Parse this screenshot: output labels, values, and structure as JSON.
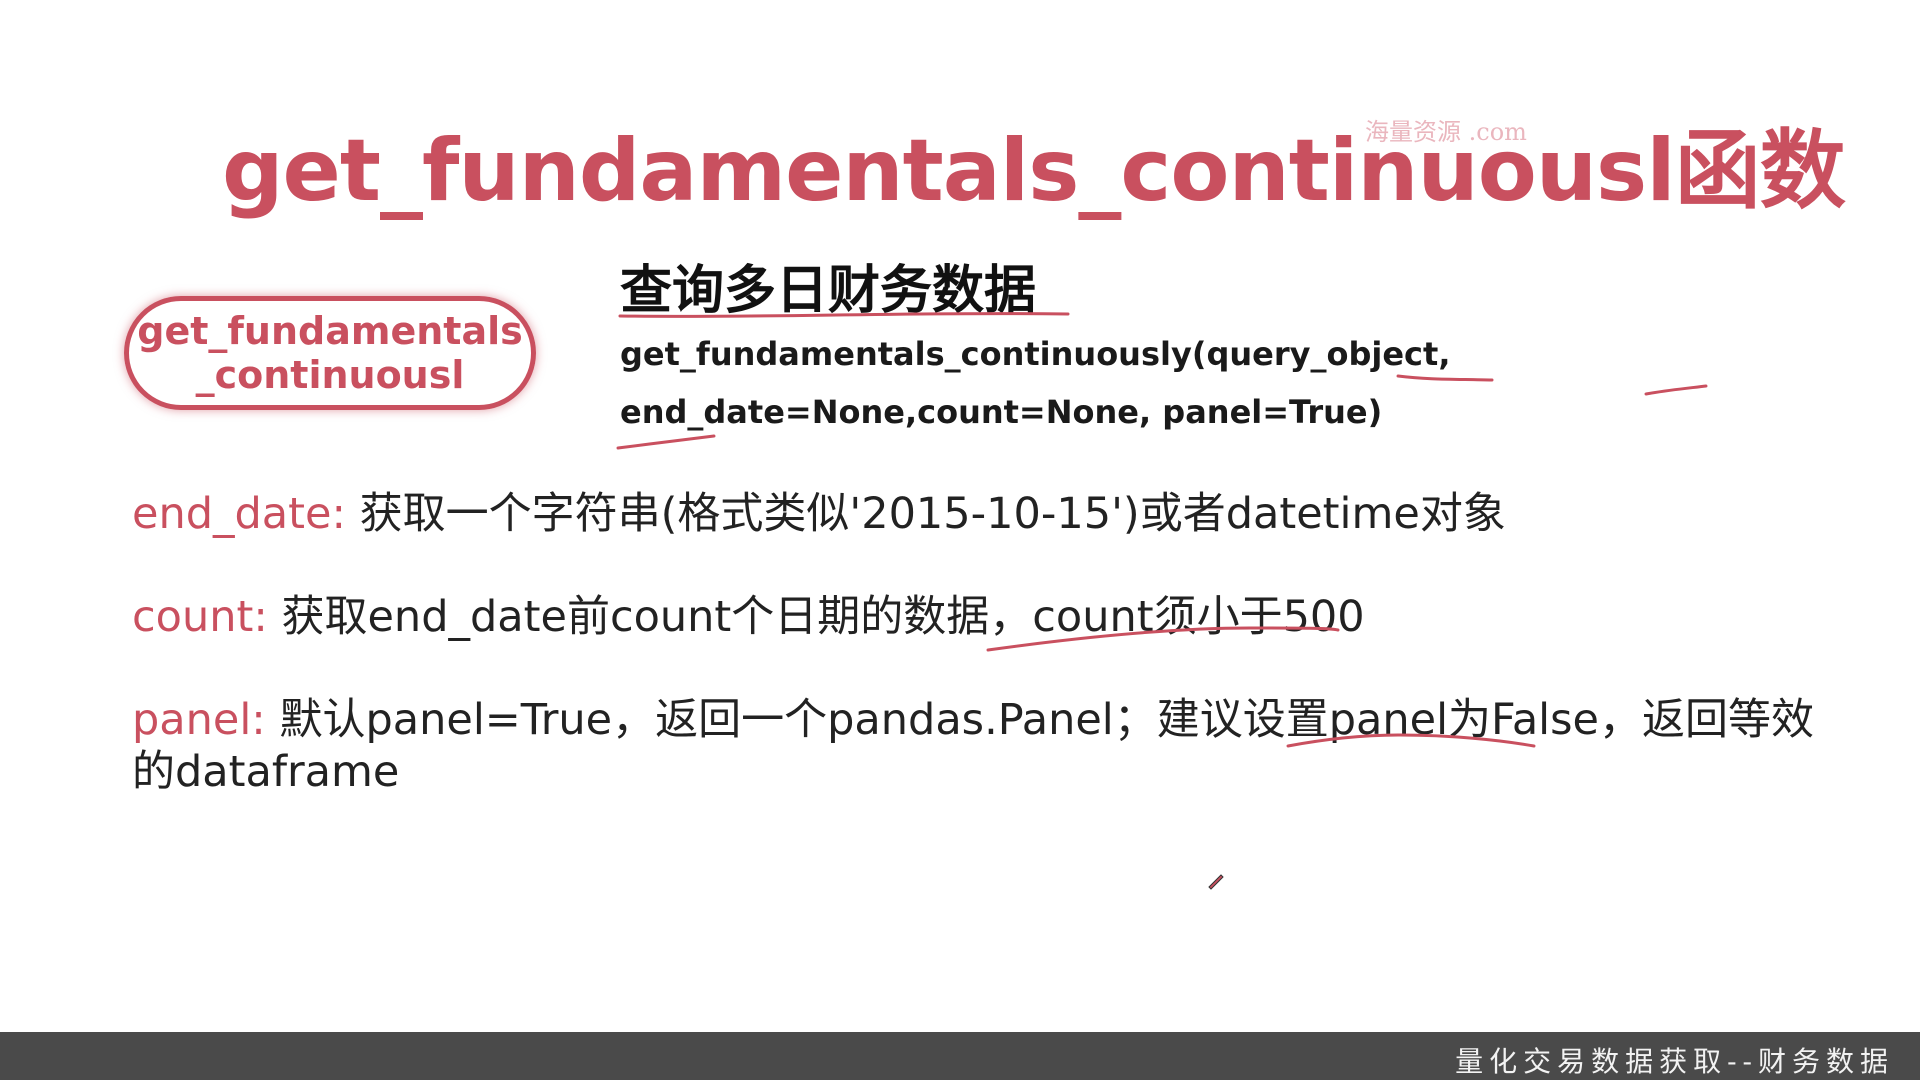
{
  "slide": {
    "title": "get_fundamentals_continuousl函数",
    "watermark": "海量资源 .com",
    "pill": {
      "line1": "get_fundamentals",
      "line2": "_continuousl"
    },
    "subheading": "查询多日财务数据",
    "signature": "get_fundamentals_continuously(query_object, end_date=None,count=None, panel=True)",
    "params": [
      {
        "key": "end_date:",
        "desc": " 获取一个字符串(格式类似'2015-10-15')或者datetime对象"
      },
      {
        "key": "count:",
        "desc": " 获取end_date前count个日期的数据，count须小于500"
      },
      {
        "key": "panel:",
        "desc": "  默认panel=True，返回一个pandas.Panel；建议设置panel为False，返回等效的dataframe"
      }
    ]
  },
  "footer": {
    "text": "量化交易数据获取--财务数据"
  },
  "colors": {
    "accent": "#c9505f",
    "footer_bg": "#4a4a4a",
    "text": "#222222"
  },
  "icons": {
    "cursor": "pen-cursor-icon"
  }
}
